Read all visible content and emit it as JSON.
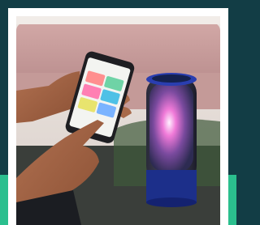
{
  "photo": {
    "subject": "hand-holding-phone-with-speaker-app",
    "colors": {
      "outer_background": "#123d45",
      "accent_band": "#2bbf8e",
      "frame": "#ffffff",
      "speaker_glow": "#f07ad8",
      "speaker_base": "#1c2f8a"
    }
  },
  "phone_app": {
    "title": "",
    "tile_colors": [
      "#ff8f8f",
      "#6fd3a6",
      "#ff7fb3",
      "#4fc1e6",
      "#e8e46e",
      "#7ab3ff"
    ]
  }
}
